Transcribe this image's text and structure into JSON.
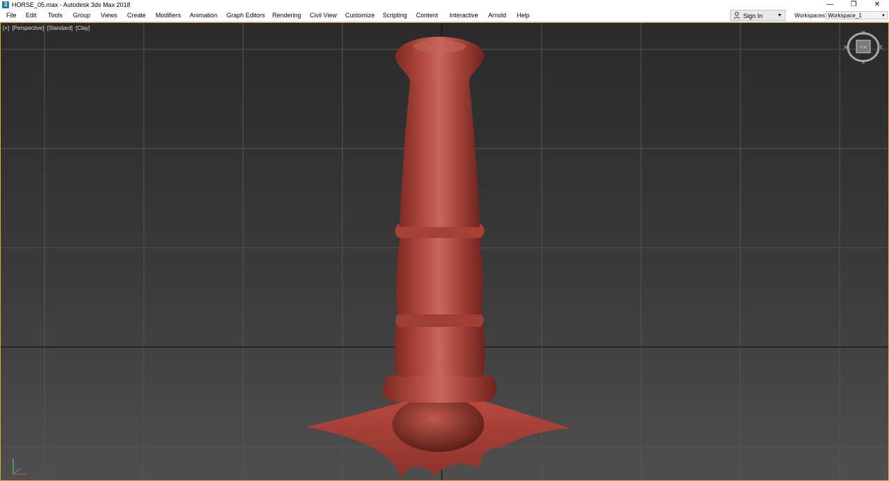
{
  "window": {
    "title": "HORSE_05.max - Autodesk 3ds Max 2018",
    "app_icon_glyph": "3",
    "controls": [
      "—",
      "❐",
      "✕"
    ]
  },
  "menubar": {
    "items": [
      "File",
      "Edit",
      "Tools",
      "Group",
      "Views",
      "Create",
      "Modifiers",
      "Animation",
      "Graph Editors",
      "Rendering",
      "Civil View",
      "Customize",
      "Scripting",
      "Content",
      "Interactive",
      "Arnold",
      "Help"
    ]
  },
  "account": {
    "sign_in_label": "Sign In",
    "user_icon": "user-icon"
  },
  "workspace": {
    "label": "Workspaces:",
    "selected": "Workspace_1"
  },
  "viewport": {
    "labels": [
      "[+]",
      "[Perspective]",
      "[Standard]",
      "[Clay]"
    ],
    "viewcube": {
      "north": "N",
      "south": "S",
      "east": "E",
      "west": "W",
      "face": "TOP"
    },
    "model_color": "#b84a40",
    "border_color": "#d9b23a"
  }
}
